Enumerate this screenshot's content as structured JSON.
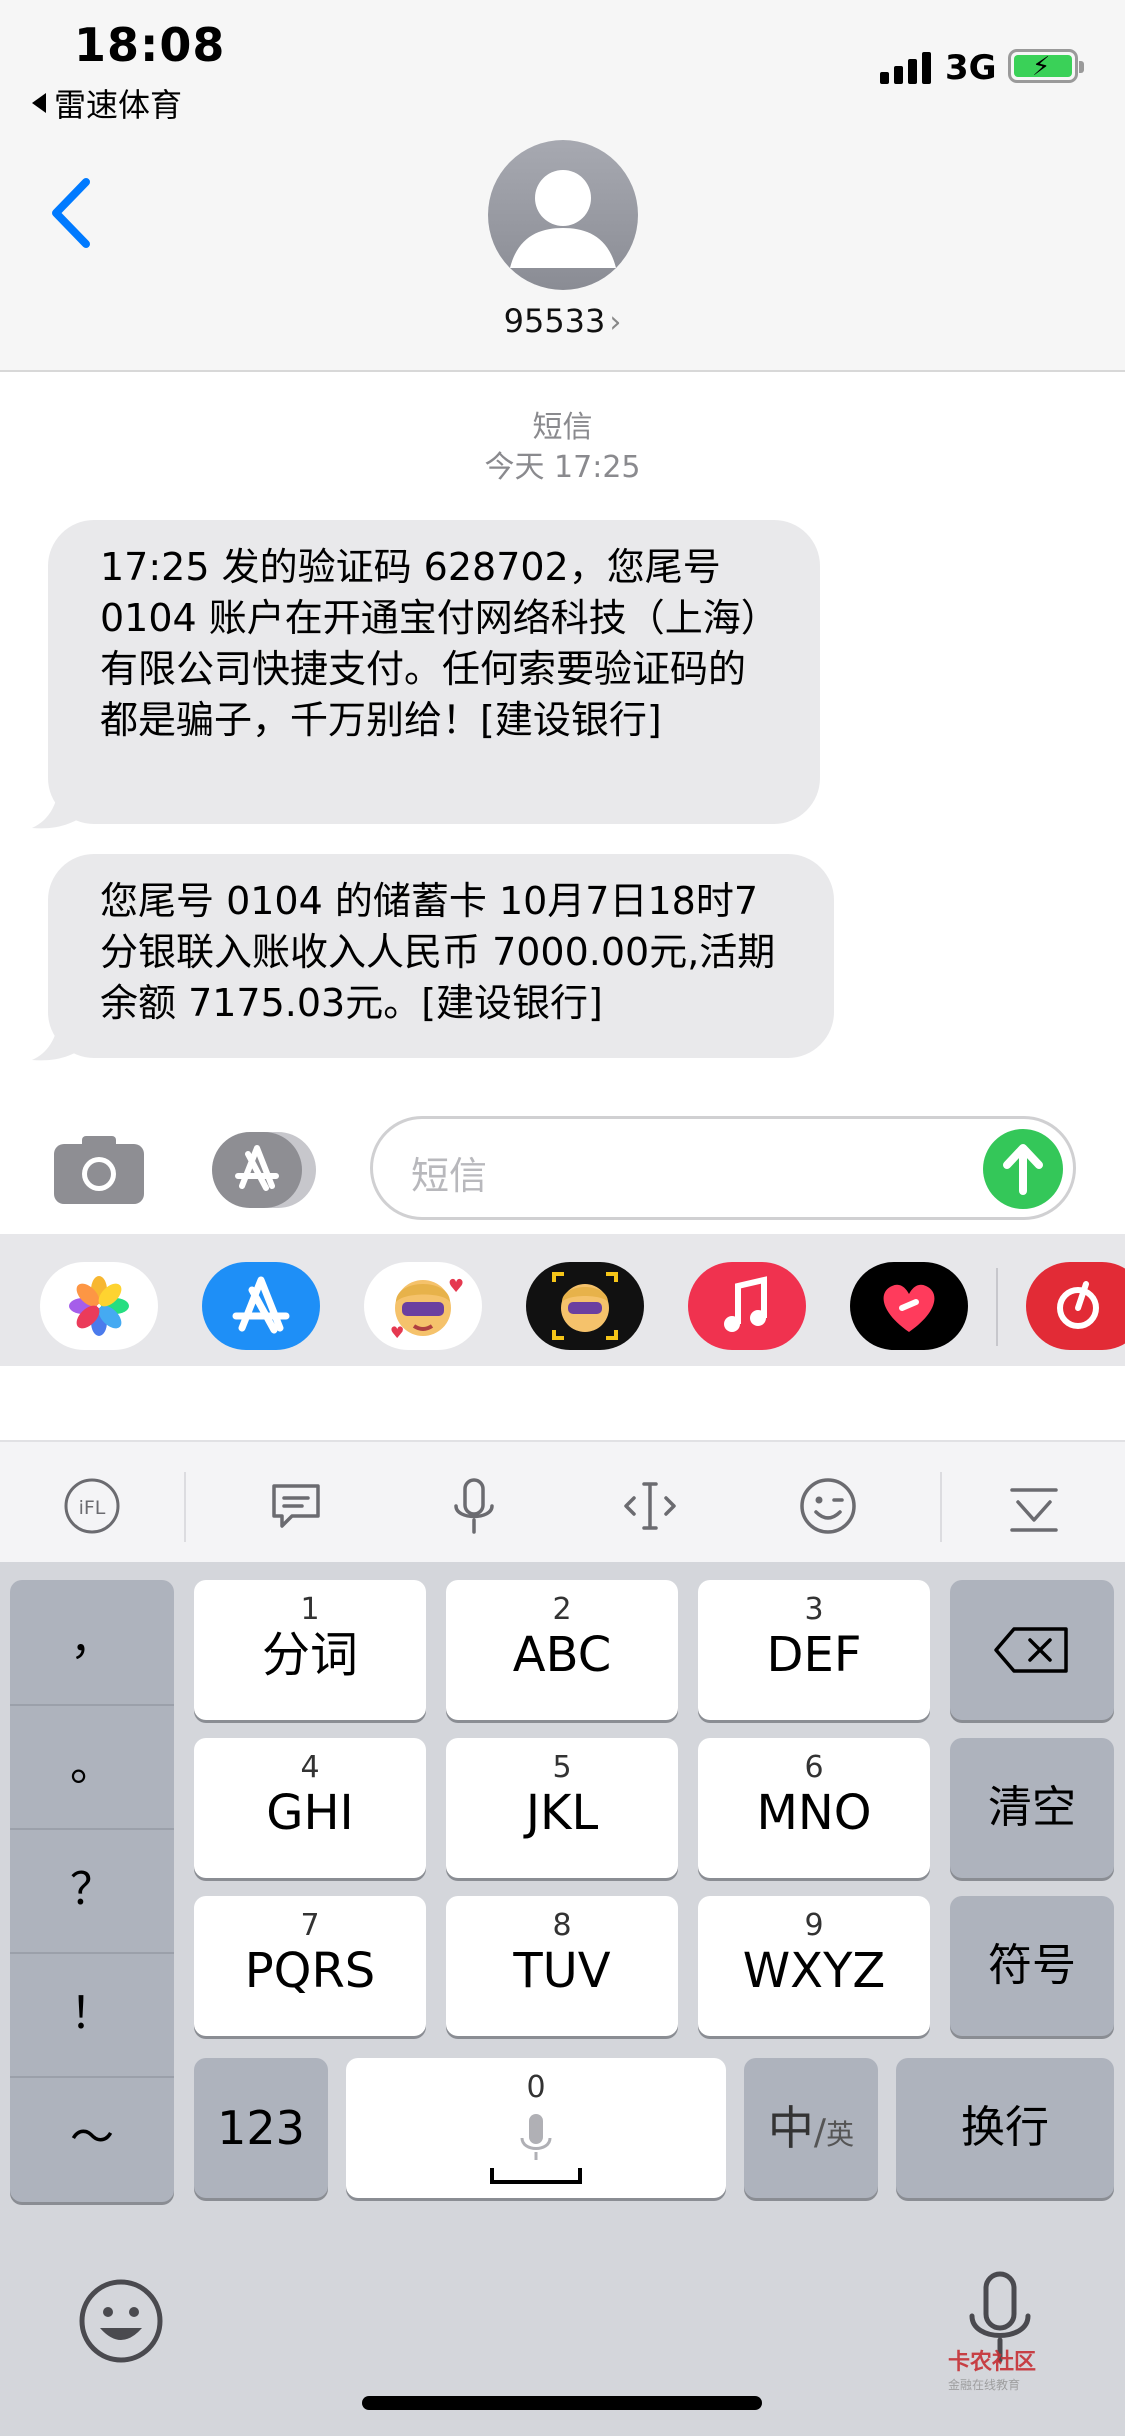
{
  "status_bar": {
    "time": "18:08",
    "back_app": "雷速体育",
    "network": "3G"
  },
  "conversation": {
    "contact": "95533"
  },
  "messages": {
    "service": "短信",
    "timestamp": "今天 17:25",
    "items": [
      {
        "text": "17:25 发的验证码 628702，您尾号 0104 账户在开通宝付网络科技（上海）有限公司快捷支付。任何索要验证码的都是骗子，千万别给！[建设银行]"
      },
      {
        "text": "您尾号 0104 的储蓄卡 10月7日18时7分银联入账收入人民币 7000.00元,活期余额 7175.03元。[建设银行]"
      }
    ]
  },
  "composer": {
    "placeholder": "短信"
  },
  "keyboard": {
    "punctuation": [
      "，",
      "。",
      "？",
      "！",
      "～"
    ],
    "keys": [
      {
        "num": "1",
        "label": "分词"
      },
      {
        "num": "2",
        "label": "ABC"
      },
      {
        "num": "3",
        "label": "DEF"
      },
      {
        "num": "4",
        "label": "GHI"
      },
      {
        "num": "5",
        "label": "JKL"
      },
      {
        "num": "6",
        "label": "MNO"
      },
      {
        "num": "7",
        "label": "PQRS"
      },
      {
        "num": "8",
        "label": "TUV"
      },
      {
        "num": "9",
        "label": "WXYZ"
      }
    ],
    "clear": "清空",
    "symbols": "符号",
    "numbers": "123",
    "space_num": "0",
    "lang_main": "中",
    "lang_alt": "英",
    "return": "换行"
  },
  "watermark": {
    "line1": "卡农社区",
    "line2": "金融在线教育"
  },
  "colors": {
    "accent": "#007aff",
    "send": "#34c759",
    "bubble": "#e9e9eb"
  }
}
